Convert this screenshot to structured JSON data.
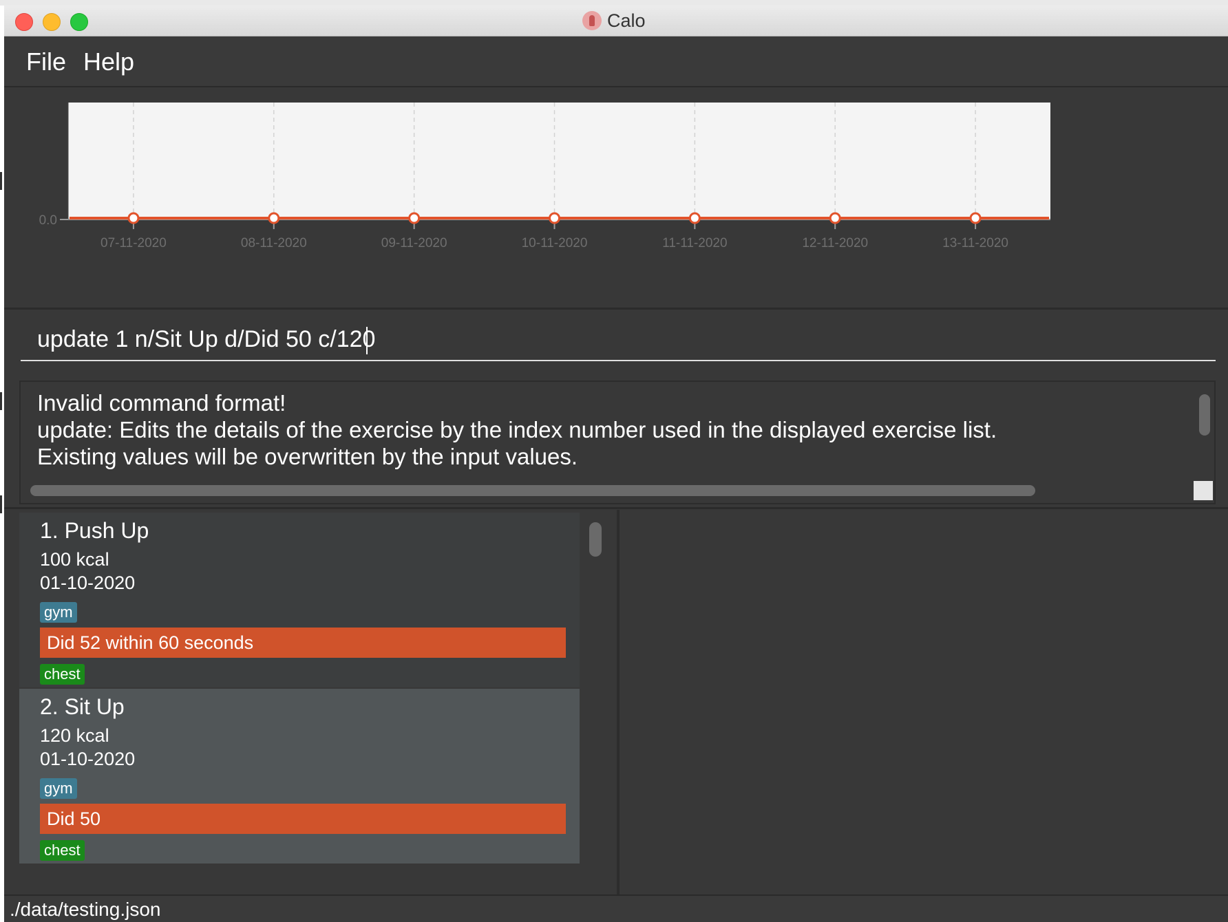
{
  "window": {
    "title": "Calo",
    "app_icon": "running-person-icon"
  },
  "menu": {
    "file": "File",
    "help": "Help"
  },
  "chart_data": {
    "type": "line",
    "x": [
      "07-11-2020",
      "08-11-2020",
      "09-11-2020",
      "10-11-2020",
      "11-11-2020",
      "12-11-2020",
      "13-11-2020"
    ],
    "series": [
      {
        "values": [
          0,
          0,
          0,
          0,
          0,
          0,
          0
        ]
      }
    ],
    "yticks": [
      "0.0"
    ],
    "ylim": [
      0,
      1
    ],
    "grid": "vertical",
    "colors": {
      "line": "#e2532b",
      "plot_bg": "#f4f4f4",
      "axis_text": "#6e6e6e"
    }
  },
  "command": {
    "value": "update 1 n/Sit Up d/Did 50 c/120"
  },
  "result": {
    "lines": [
      "Invalid command format!",
      "update: Edits the details of the exercise by the index number used in the displayed exercise list.",
      "Existing values will be overwritten by the input values."
    ]
  },
  "exercises": [
    {
      "name": "1.  Push Up",
      "calories": "100  kcal",
      "date": "01-10-2020",
      "tag1": "gym",
      "description": "Did 52 within 60 seconds",
      "tag2": "chest"
    },
    {
      "name": "2.  Sit Up",
      "calories": "120  kcal",
      "date": "01-10-2020",
      "tag1": "gym",
      "description": "Did 50",
      "tag2": "chest"
    }
  ],
  "status": {
    "file_path": "./data/testing.json"
  },
  "colors": {
    "panel": "#383838",
    "description_bar": "#d0532b",
    "tag_gym": "#3e7b91",
    "tag_chest": "#1a8a1a"
  }
}
